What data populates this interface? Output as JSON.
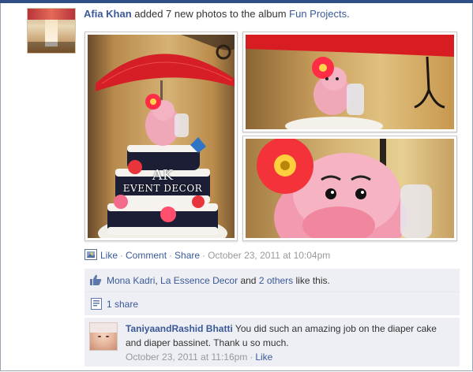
{
  "story": {
    "actor": "Afia Khan",
    "verb_text": " added 7 new photos to the album ",
    "album": "Fun Projects",
    "suffix": "."
  },
  "photos": [
    {
      "watermark_line1": "AK",
      "watermark_line2": "EVENT DECOR"
    },
    {},
    {}
  ],
  "actions": {
    "like": "Like",
    "comment": "Comment",
    "share": "Share",
    "separator": "·",
    "timestamp": "October 23, 2011 at 10:04pm"
  },
  "likes": {
    "name1": "Mona Kadri",
    "sep1": ", ",
    "name2": "La Essence Decor",
    "conj": " and ",
    "others": "2 others",
    "suffix": " like this."
  },
  "shares": {
    "label": "1 share"
  },
  "comment": {
    "author": "TaniyaandRashid Bhatti",
    "text": " You did such an amazing job on the diaper cake and diaper bassinet. Thank u so much.",
    "timestamp": "October 23, 2011 at 11:16pm",
    "separator": "·",
    "like": "Like"
  },
  "colors": {
    "link": "#3b5998",
    "ufi_background": "#edeff4",
    "muted": "#999999",
    "topbar": "#2f4f86"
  },
  "icons": {
    "action": "photo-album-icon",
    "likes": "thumbs-up-icon",
    "shares": "share-doc-icon"
  }
}
